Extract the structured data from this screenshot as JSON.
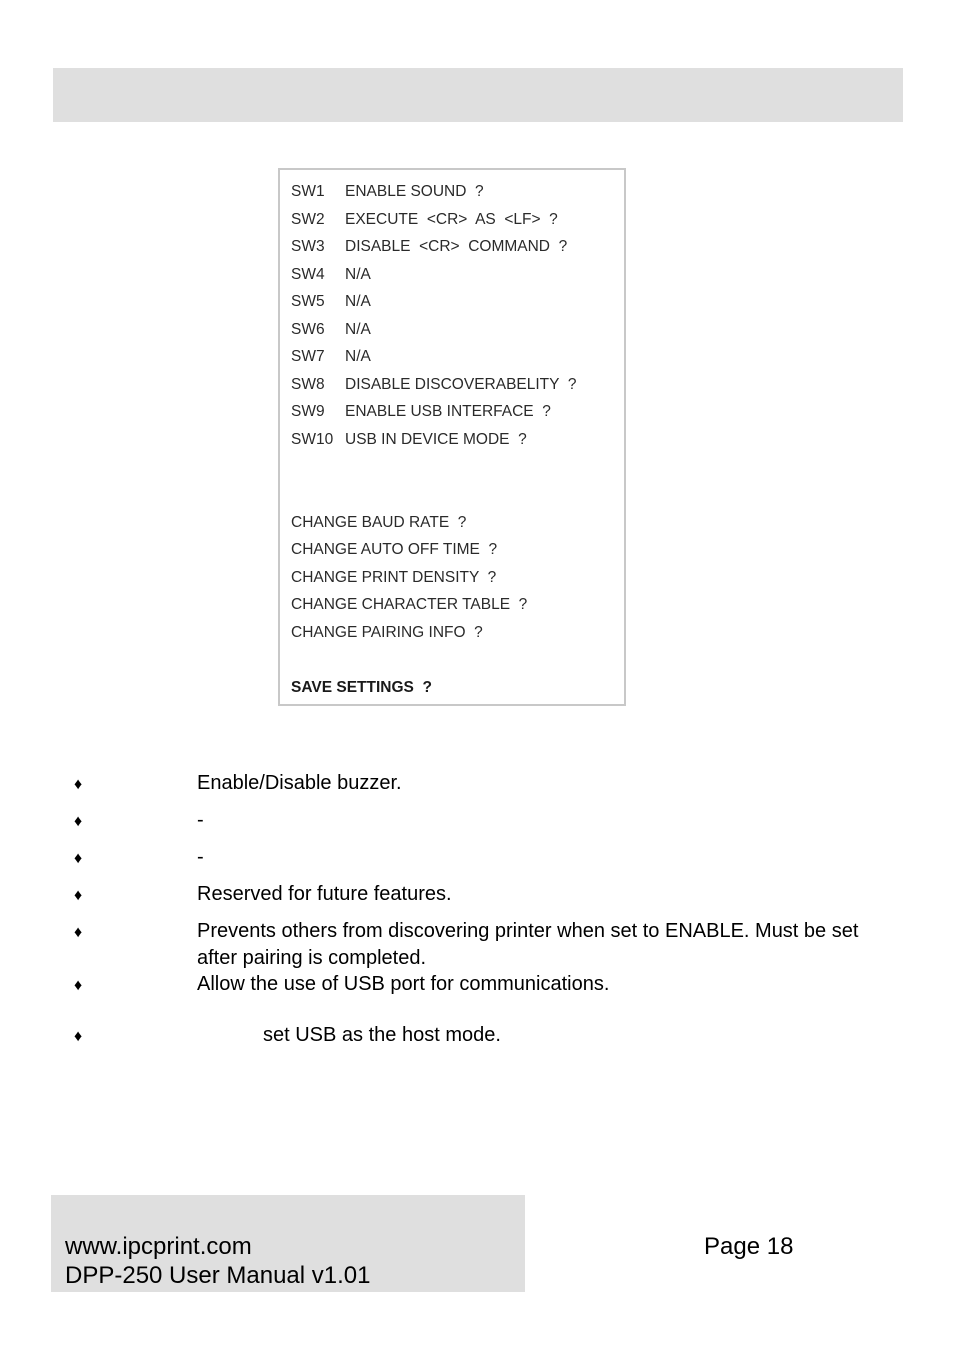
{
  "header": {
    "bar": ""
  },
  "menu": {
    "switches": [
      {
        "id": "SW1",
        "label": "ENABLE SOUND  ?"
      },
      {
        "id": "SW2",
        "label": "EXECUTE  <CR>  AS  <LF>  ?"
      },
      {
        "id": "SW3",
        "label": "DISABLE  <CR>  COMMAND  ?"
      },
      {
        "id": "SW4",
        "label": "N/A"
      },
      {
        "id": "SW5",
        "label": "N/A"
      },
      {
        "id": "SW6",
        "label": "N/A"
      },
      {
        "id": "SW7",
        "label": "N/A"
      },
      {
        "id": "SW8",
        "label": "DISABLE DISCOVERABELITY  ?"
      },
      {
        "id": "SW9",
        "label": "ENABLE USB INTERFACE  ?"
      },
      {
        "id": "SW10",
        "label": "USB IN DEVICE MODE  ?"
      }
    ],
    "changes": [
      "CHANGE BAUD RATE  ?",
      "CHANGE AUTO OFF TIME  ?",
      "CHANGE PRINT DENSITY  ?",
      "CHANGE CHARACTER TABLE  ?",
      "CHANGE PAIRING INFO  ?"
    ],
    "save": "SAVE SETTINGS  ?"
  },
  "descriptions": [
    {
      "bullet": "♦",
      "text": "Enable/Disable buzzer."
    },
    {
      "bullet": "♦",
      "text": "-"
    },
    {
      "bullet": "♦",
      "text": "-"
    },
    {
      "bullet": "♦",
      "text": "Reserved for future features."
    },
    {
      "bullet": "♦",
      "text": "Prevents others from discovering printer when set to ENABLE. Must be set after pairing is completed."
    },
    {
      "bullet": "♦",
      "text": "Allow the use of USB port for communications."
    },
    {
      "bullet": "♦",
      "text": "set USB as the host mode."
    }
  ],
  "footer": {
    "website": "www.ipcprint.com",
    "manual": "DPP-250 User Manual v1.01",
    "page": "Page 18"
  }
}
